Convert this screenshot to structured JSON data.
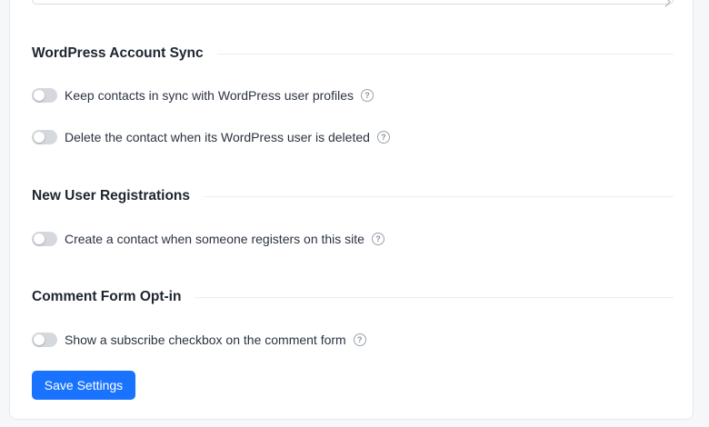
{
  "sections": [
    {
      "title": "WordPress Account Sync",
      "options": [
        {
          "label": "Keep contacts in sync with WordPress user profiles",
          "enabled": false,
          "help_icon": "question-circle-icon"
        },
        {
          "label": "Delete the contact when its WordPress user is deleted",
          "enabled": false,
          "help_icon": "question-circle-icon"
        }
      ]
    },
    {
      "title": "New User Registrations",
      "options": [
        {
          "label": "Create a contact when someone registers on this site",
          "enabled": false,
          "help_icon": "question-circle-icon"
        }
      ]
    },
    {
      "title": "Comment Form Opt-in",
      "options": [
        {
          "label": "Show a subscribe checkbox on the comment form",
          "enabled": false,
          "help_icon": "question-circle-icon"
        }
      ]
    }
  ],
  "actions": {
    "save_label": "Save Settings"
  },
  "colors": {
    "accent": "#1a73ff",
    "toggle_off": "#d5d8dd",
    "card_border": "#e4e7ec"
  }
}
